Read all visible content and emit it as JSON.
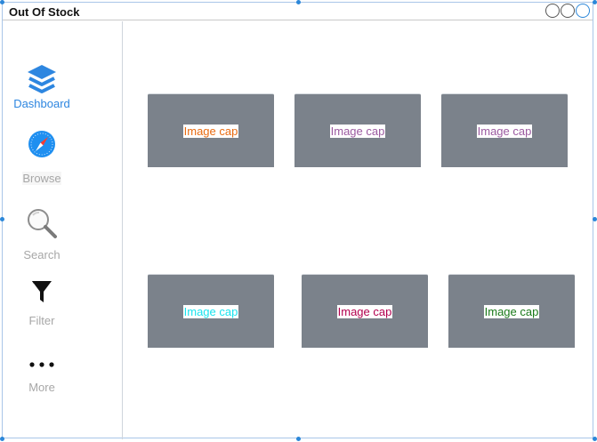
{
  "window": {
    "title": "Out Of Stock",
    "controls": [
      "minimize",
      "maximize",
      "close"
    ]
  },
  "sidebar": {
    "items": [
      {
        "label": "Dashboard",
        "icon": "layers-icon",
        "active": true
      },
      {
        "label": "Browse",
        "icon": "safari-compass-icon",
        "active": false
      },
      {
        "label": "Search",
        "icon": "magnifier-icon",
        "active": false
      },
      {
        "label": "Filter",
        "icon": "funnel-icon",
        "active": false
      },
      {
        "label": "More",
        "icon": "ellipsis-icon",
        "active": false
      }
    ]
  },
  "main": {
    "cards": [
      {
        "caption": "Image cap",
        "color": "#e86a10"
      },
      {
        "caption": "Image cap",
        "color": "#9b5aa0"
      },
      {
        "caption": "Image cap",
        "color": "#9b5aa0"
      },
      {
        "caption": "Image cap",
        "color": "#18e3ee"
      },
      {
        "caption": "Image cap",
        "color": "#b3004f"
      },
      {
        "caption": "Image cap",
        "color": "#1a7a1a"
      }
    ]
  },
  "colors": {
    "accent": "#2d86e0",
    "card_bg": "#7b828b",
    "inactive_label": "#a7a7a7"
  }
}
